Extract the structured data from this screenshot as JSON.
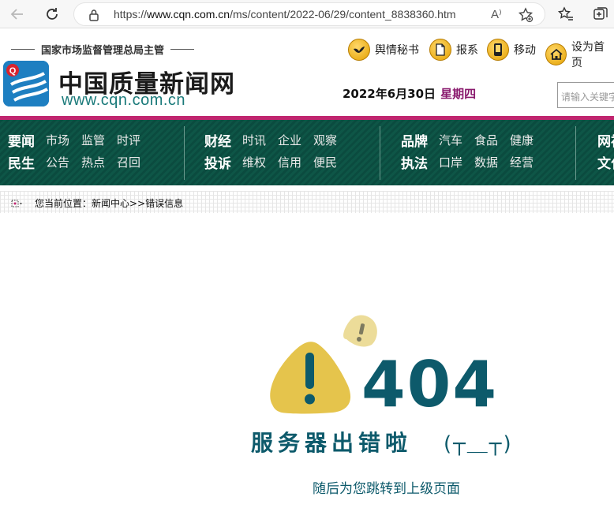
{
  "browser": {
    "url_prefix": "https://",
    "url_host": "www.cqn.com.cn",
    "url_path": "/ms/content/2022-06/29/content_8838360.htm",
    "read_aloud": "A⁾"
  },
  "header": {
    "sponsor": "国家市场监督管理总局主管",
    "site_name": "中国质量新闻网",
    "site_url": "www.cqn.com.cn",
    "quick_links": [
      "舆情秘书",
      "报系",
      "移动",
      "设为首页"
    ],
    "date": "2022年6月30日",
    "weekday": "星期四",
    "search_placeholder": "请输入关键字"
  },
  "nav": {
    "groups": [
      {
        "rows": [
          {
            "cat": "要闻",
            "items": [
              "市场",
              "监管",
              "时评"
            ]
          },
          {
            "cat": "民生",
            "items": [
              "公告",
              "热点",
              "召回"
            ]
          }
        ]
      },
      {
        "rows": [
          {
            "cat": "财经",
            "items": [
              "时讯",
              "企业",
              "观察"
            ]
          },
          {
            "cat": "投诉",
            "items": [
              "维权",
              "信用",
              "便民"
            ]
          }
        ]
      },
      {
        "rows": [
          {
            "cat": "品牌",
            "items": [
              "汽车",
              "食品",
              "健康"
            ]
          },
          {
            "cat": "执法",
            "items": [
              "口岸",
              "数据",
              "经营"
            ]
          }
        ]
      },
      {
        "rows": [
          {
            "cat": "网视",
            "items": []
          },
          {
            "cat": "文化",
            "items": []
          }
        ]
      }
    ]
  },
  "breadcrumb": {
    "label": "您当前位置：",
    "path": "新闻中心>>错误信息"
  },
  "error": {
    "code": "404",
    "title": "服务器出错啦",
    "face": "(┬＿┬)",
    "subtitle": "随后为您跳转到上级页面"
  },
  "colors": {
    "nav_bg": "#0b4b3f",
    "accent_stripe": "#c0256f",
    "error_text": "#0d5a6b",
    "warning_yellow": "#e5c44c"
  }
}
